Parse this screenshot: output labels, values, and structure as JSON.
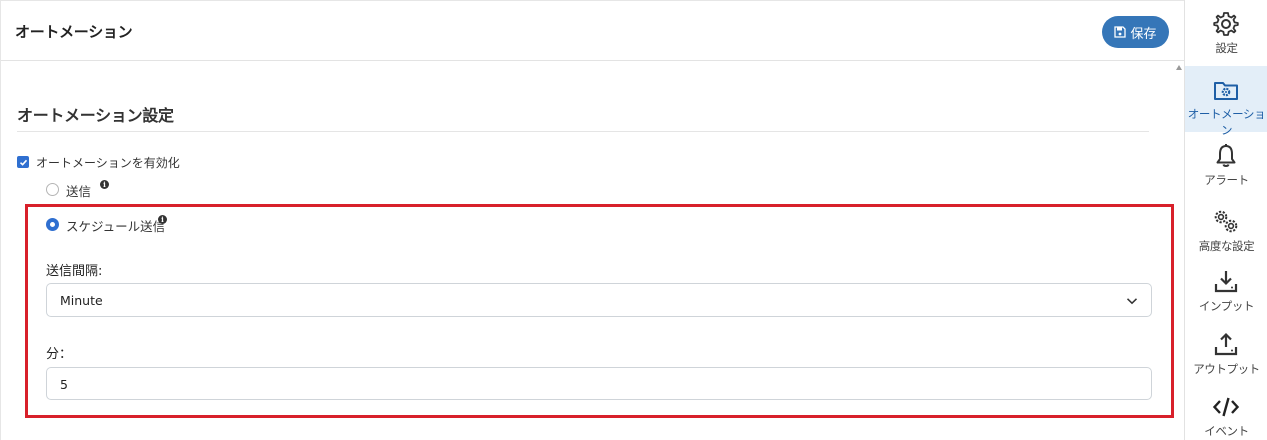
{
  "header": {
    "title": "オートメーション",
    "save_label": "保存"
  },
  "section": {
    "title": "オートメーション設定"
  },
  "enable": {
    "label": "オートメーションを有効化",
    "checked": true
  },
  "modes": [
    {
      "label": "送信",
      "selected": false
    },
    {
      "label": "スケジュール送信",
      "selected": true
    }
  ],
  "interval": {
    "label": "送信間隔:",
    "value": "Minute"
  },
  "minutes": {
    "label": "分：",
    "value": "5"
  },
  "sidebar": {
    "items": [
      {
        "label": "設定",
        "icon": "gear-icon"
      },
      {
        "label": "オートメーション",
        "icon": "folder-gear-icon",
        "active": true
      },
      {
        "label": "アラート",
        "icon": "bell-icon"
      },
      {
        "label": "高度な設定",
        "icon": "gears-icon"
      },
      {
        "label": "インプット",
        "icon": "download-icon"
      },
      {
        "label": "アウトプット",
        "icon": "upload-icon"
      },
      {
        "label": "イベント",
        "icon": "code-icon"
      }
    ]
  },
  "colors": {
    "accent": "#3576b8",
    "highlight": "#d8202a",
    "active_bg": "#e3eef8"
  }
}
